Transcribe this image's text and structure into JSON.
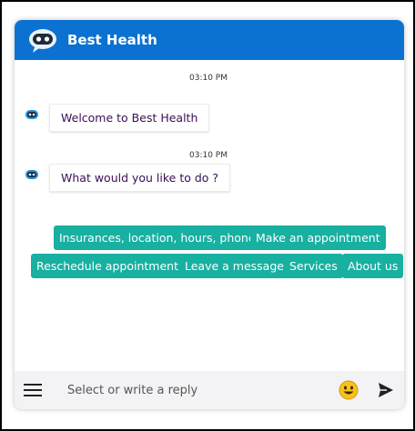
{
  "header": {
    "title": "Best Health",
    "icon": "robot-icon",
    "color": "#0b72d1"
  },
  "messages": [
    {
      "time": "03:10 PM",
      "text": "Welcome to Best Health",
      "avatar": "robot-icon"
    },
    {
      "time": "03:10 PM",
      "text": "What would you like to do ?",
      "avatar": "robot-icon"
    }
  ],
  "quick_replies": [
    "Insurances, location, hours, phone",
    "Make an appointment",
    "Reschedule appointment",
    "Leave a message",
    "Services",
    "About us"
  ],
  "quick_reply_color": "#17b0a1",
  "footer": {
    "placeholder": "Select or write a reply",
    "menu_icon": "hamburger-icon",
    "emoji_icon": "smiley-emoji-icon",
    "send_icon": "send-icon"
  }
}
